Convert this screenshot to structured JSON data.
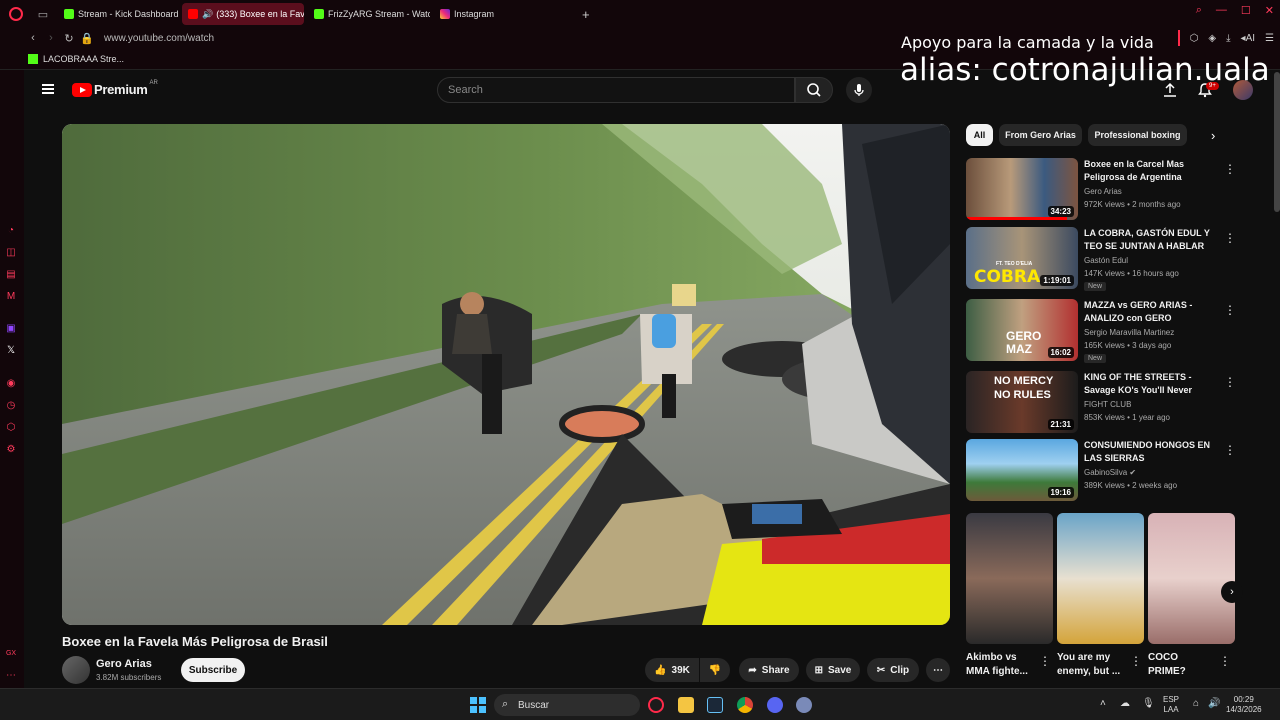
{
  "browser": {
    "tabs": [
      {
        "label": "Stream - Kick Dashboard",
        "color": "#53fc18"
      },
      {
        "label": "(333) Boxee en la Fave",
        "color": "#ff0000"
      },
      {
        "label": "FrizZyARG Stream - Watc",
        "color": "#53fc18"
      },
      {
        "label": "Instagram",
        "color": "#e1306c"
      }
    ],
    "url": "www.youtube.com/watch",
    "bookmark": "LACOBRAAA Stre...",
    "ai_label": "AI"
  },
  "overlay": {
    "line1": "Apoyo para la camada y la vida",
    "line2": "alias: cotronajulian.uala"
  },
  "youtube": {
    "logo_text": "Premium",
    "logo_region": "AR",
    "search_placeholder": "Search",
    "notif_count": "9+",
    "video": {
      "title": "Boxee en la Favela Más Peligrosa de Brasil",
      "channel": "Gero Arias",
      "subscribers": "3.82M subscribers",
      "subscribe_label": "Subscribe",
      "likes": "39K",
      "share_label": "Share",
      "save_label": "Save",
      "clip_label": "Clip"
    },
    "chips": [
      "All",
      "From Gero Arias",
      "Professional boxing"
    ],
    "recommendations": [
      {
        "title": "Boxee en la Carcel Mas Peligrosa de Argentina",
        "channel": "Gero Arias",
        "meta": "972K views • 2 months ago",
        "duration": "34:23",
        "new": ""
      },
      {
        "title": "LA COBRA, GASTÓN EDUL Y TEO SE JUNTAN A HABLAR D...",
        "channel": "Gastón Edul",
        "meta": "147K views • 16 hours ago",
        "duration": "1:19:01",
        "new": "New"
      },
      {
        "title": "MAZZA vs GERO ARIAS - ANALIZO con GERO",
        "channel": "Sergio Maravilla Martinez",
        "meta": "165K views • 3 days ago",
        "duration": "16:02",
        "new": "New"
      },
      {
        "title": "KING OF THE STREETS - Savage KO's You'll Never Forget!",
        "channel": "FIGHT CLUB",
        "meta": "853K views • 1 year ago",
        "duration": "21:31",
        "new": ""
      },
      {
        "title": "CONSUMIENDO HONGOS EN LAS SIERRAS",
        "channel": "GabinoSilva",
        "meta": "389K views • 2 weeks ago",
        "duration": "19:16",
        "new": ""
      }
    ],
    "thumb_text": {
      "cobra": "COBRA",
      "cobra_ft": "FT. TEO D'ELIA",
      "gero": "GERO",
      "maz": "MAZ",
      "nomercy1": "NO MERCY",
      "nomercy2": "NO RULES"
    },
    "shorts": [
      {
        "title": "Akimbo vs MMA fighte..."
      },
      {
        "title": "You are my enemy, but ..."
      },
      {
        "title": "COCO PRIME?"
      }
    ]
  },
  "taskbar": {
    "search_label": "Buscar",
    "lang": "ESP",
    "layout": "LAA",
    "time": "00:29",
    "date": "14/3/2026"
  }
}
